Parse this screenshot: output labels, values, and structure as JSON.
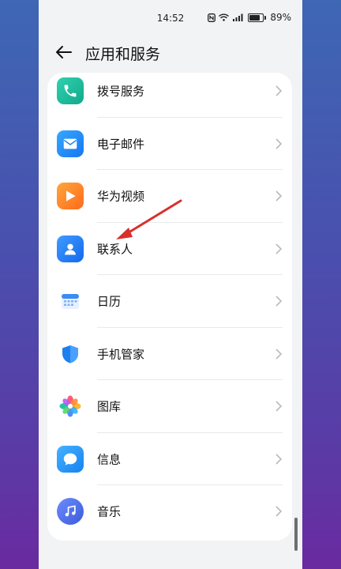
{
  "status_bar": {
    "time": "14:52",
    "battery": "89%"
  },
  "header": {
    "title": "应用和服务"
  },
  "items": [
    {
      "label": "拨号服务",
      "icon": "phone-icon"
    },
    {
      "label": "电子邮件",
      "icon": "email-icon"
    },
    {
      "label": "华为视频",
      "icon": "video-icon"
    },
    {
      "label": "联系人",
      "icon": "contacts-icon"
    },
    {
      "label": "日历",
      "icon": "calendar-icon"
    },
    {
      "label": "手机管家",
      "icon": "shield-icon"
    },
    {
      "label": "图库",
      "icon": "gallery-icon"
    },
    {
      "label": "信息",
      "icon": "message-icon"
    },
    {
      "label": "音乐",
      "icon": "music-icon"
    }
  ],
  "colors": {
    "annotation_arrow": "#d8312b"
  }
}
